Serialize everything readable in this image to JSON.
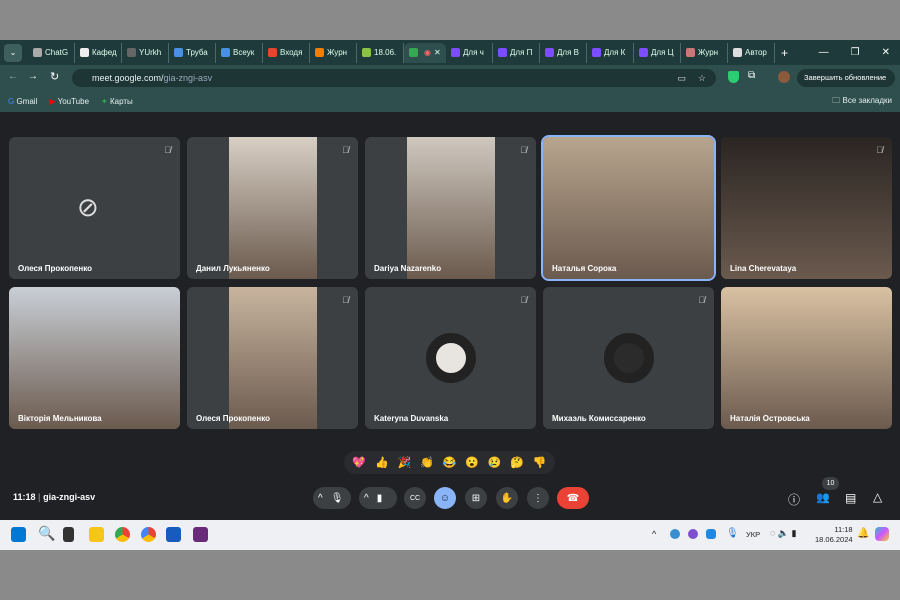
{
  "tabs": [
    {
      "label": "ChatG",
      "color": "#aaa"
    },
    {
      "label": "Кафед",
      "color": "#eee"
    },
    {
      "label": "YUrkh",
      "color": "#666"
    },
    {
      "label": "Труба",
      "color": "#4a90e2"
    },
    {
      "label": "Всеук",
      "color": "#4a90e2"
    },
    {
      "label": "Входя",
      "color": "#ea4335"
    },
    {
      "label": "Журн",
      "color": "#f57c00"
    },
    {
      "label": "18.06.",
      "color": "#8bc34a"
    },
    {
      "label": "",
      "color": "#34a853"
    },
    {
      "label": "Для ч",
      "color": "#7c4dff"
    },
    {
      "label": "Для П",
      "color": "#7c4dff"
    },
    {
      "label": "Для В",
      "color": "#7c4dff"
    },
    {
      "label": "Для К",
      "color": "#7c4dff"
    },
    {
      "label": "Для Ц",
      "color": "#7c4dff"
    },
    {
      "label": "Журн",
      "color": "#c77"
    },
    {
      "label": "Автор",
      "color": "#ddd"
    }
  ],
  "address": {
    "host": "meet.google.com/",
    "path": "gia-zngi-asv",
    "update_label": "Завершить обновление"
  },
  "bookmarks": [
    {
      "label": "Gmail"
    },
    {
      "label": "YouTube"
    },
    {
      "label": "Карты"
    }
  ],
  "all_bookmarks": "Все закладки",
  "participants": [
    {
      "name": "Олеся Прокопенко",
      "video": false
    },
    {
      "name": "Данил Лукьяненко",
      "video": true,
      "bg": "#d8cfc4"
    },
    {
      "name": "Dariya Nazarenko",
      "video": true,
      "bg": "#cfc8bf"
    },
    {
      "name": "Наталья Сорока",
      "video": true,
      "bg": "#b8a58e",
      "speaking": true
    },
    {
      "name": "Lina Cherevataya",
      "video": true,
      "bg": "#2a2522"
    },
    {
      "name": "Вікторія Мельникова",
      "video": true,
      "bg": "#c9cfd6"
    },
    {
      "name": "Олеся Прокопенко",
      "video": true,
      "bg": "#c8b49e"
    },
    {
      "name": "Kateryna Duvanska",
      "video": false,
      "avatar": "#e8e4e0"
    },
    {
      "name": "Михаэль Комиссаренко",
      "video": false,
      "avatar": "#2b2b2b"
    },
    {
      "name": "Наталія Островська",
      "video": true,
      "bg": "#d9c1a2"
    }
  ],
  "reactions": [
    "💖",
    "👍",
    "🎉",
    "👏",
    "😂",
    "😮",
    "😢",
    "🤔",
    "👎"
  ],
  "meeting": {
    "time": "11:18",
    "code": "gia-zngi-asv",
    "participant_count": "10"
  },
  "taskbar": {
    "lang": "УКР",
    "time": "11:18",
    "date": "18.06.2024"
  }
}
